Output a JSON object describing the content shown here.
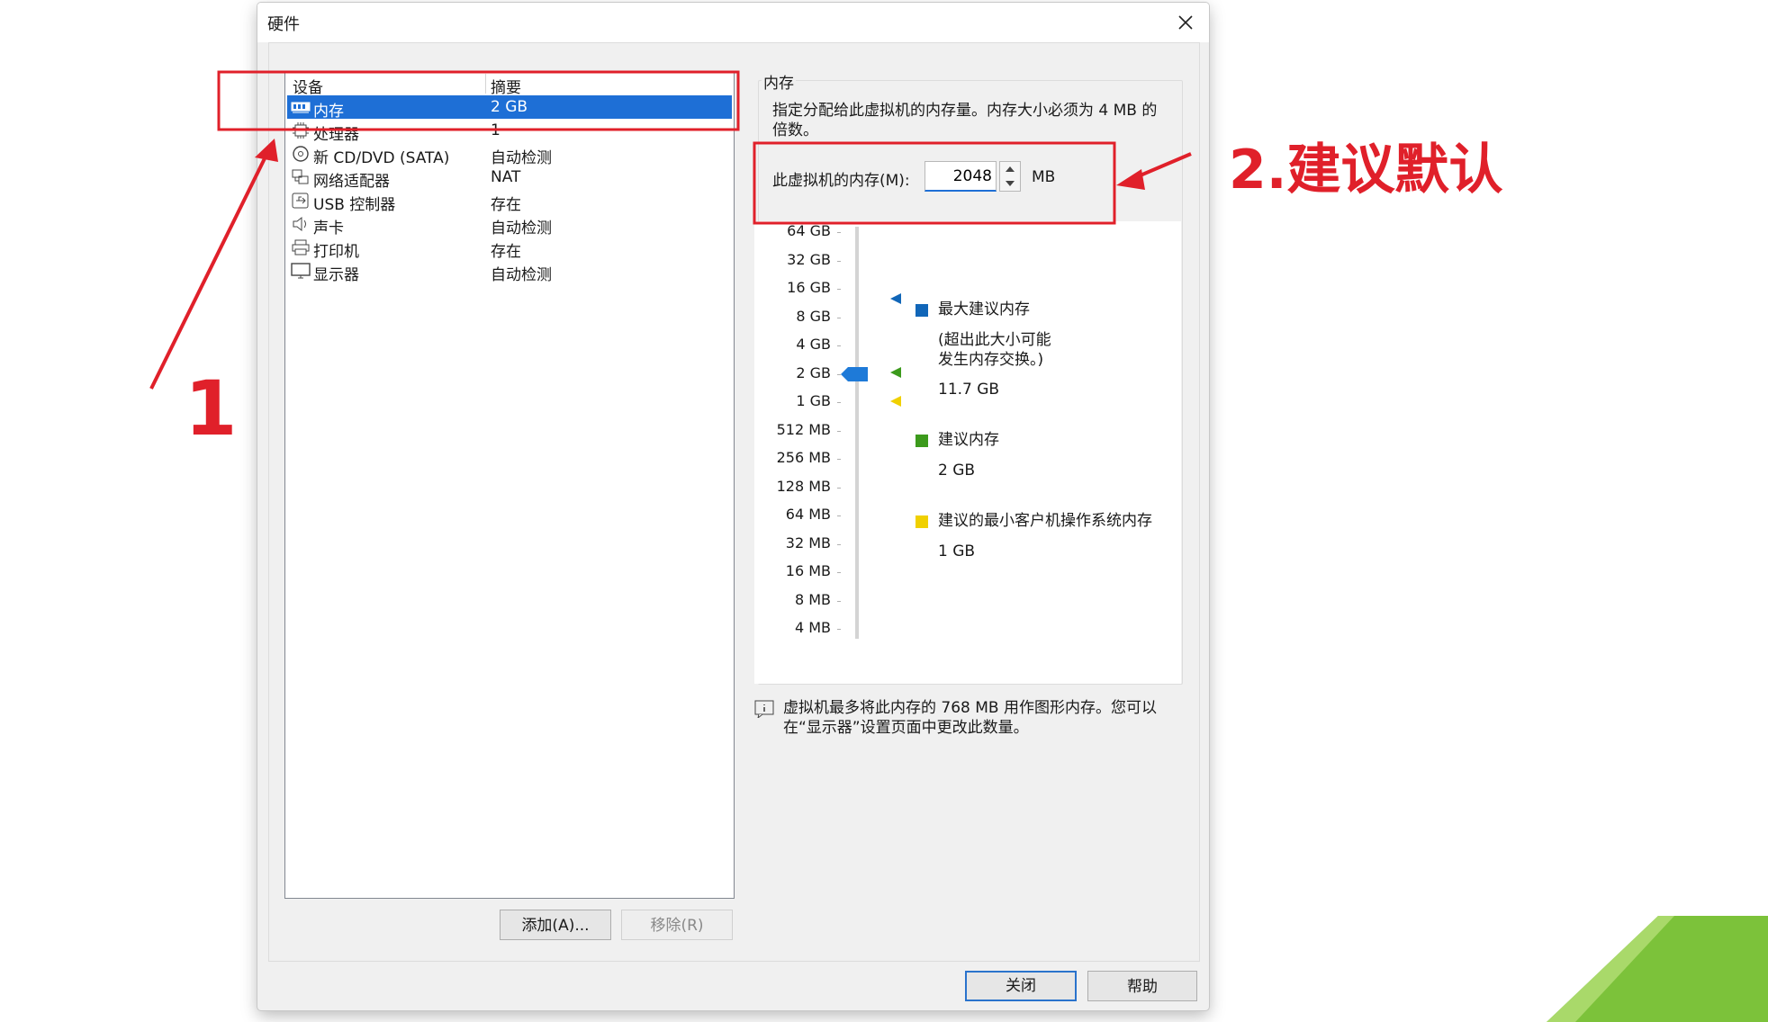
{
  "window": {
    "title": "硬件"
  },
  "device_list": {
    "col_device": "设备",
    "col_summary": "摘要",
    "rows": [
      {
        "name": "内存",
        "summary": "2 GB",
        "icon": "memory-icon"
      },
      {
        "name": "处理器",
        "summary": "1",
        "icon": "cpu-icon"
      },
      {
        "name": "新 CD/DVD (SATA)",
        "summary": "自动检测",
        "icon": "cd-icon"
      },
      {
        "name": "网络适配器",
        "summary": "NAT",
        "icon": "network-icon"
      },
      {
        "name": "USB 控制器",
        "summary": "存在",
        "icon": "usb-icon"
      },
      {
        "name": "声卡",
        "summary": "自动检测",
        "icon": "speaker-icon"
      },
      {
        "name": "打印机",
        "summary": "存在",
        "icon": "printer-icon"
      },
      {
        "name": "显示器",
        "summary": "自动检测",
        "icon": "monitor-icon"
      }
    ]
  },
  "buttons": {
    "add": "添加(A)...",
    "remove": "移除(R)",
    "close": "关闭",
    "help": "帮助"
  },
  "memory": {
    "group_title": "内存",
    "description": "指定分配给此虚拟机的内存量。内存大小必须为 4 MB 的倍数。",
    "label": "此虚拟机的内存(M):",
    "value": "2048",
    "unit": "MB",
    "scale": [
      "64 GB",
      "32 GB",
      "16 GB",
      "8 GB",
      "4 GB",
      "2 GB",
      "1 GB",
      "512 MB",
      "256 MB",
      "128 MB",
      "64 MB",
      "32 MB",
      "16 MB",
      "8 MB",
      "4 MB"
    ],
    "max_recommended": {
      "label": "最大建议内存",
      "note_line1": "(超出此大小可能",
      "note_line2": "发生内存交换。)",
      "value": "11.7 GB",
      "color": "#1166b8"
    },
    "recommended": {
      "label": "建议内存",
      "value": "2 GB",
      "color": "#3c9a1c"
    },
    "min_guest": {
      "label": "建议的最小客户机操作系统内存",
      "value": "1 GB",
      "color": "#f0d000"
    },
    "info_line1": "虚拟机最多将此内存的 768 MB 用作图形内存。您可以",
    "info_line2": "在“显示器”设置页面中更改此数量。"
  },
  "annotations": {
    "step1": "1",
    "step2": "2.建议默认",
    "color": "#e0202a"
  }
}
